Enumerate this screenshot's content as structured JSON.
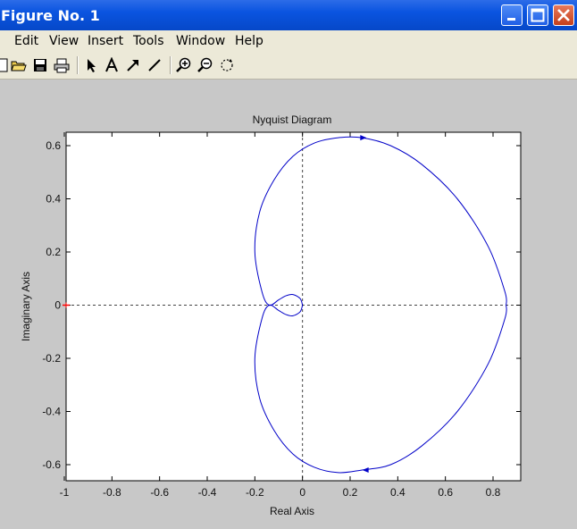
{
  "window": {
    "title": "Figure No. 1"
  },
  "menu": {
    "items": [
      "Edit",
      "View",
      "Insert",
      "Tools",
      "Window",
      "Help"
    ]
  },
  "toolbar": {
    "tools": [
      "open-folder-icon",
      "save-icon",
      "print-icon",
      "arrow-select-icon",
      "text-tool-icon",
      "arrow-tool-icon",
      "line-tool-icon",
      "zoom-in-icon",
      "zoom-out-icon",
      "rotate-icon"
    ]
  },
  "chart_data": {
    "type": "line",
    "title": "Nyquist Diagram",
    "xlabel": "Real Axis",
    "ylabel": "Imaginary Axis",
    "xlim": [
      -1,
      0.9
    ],
    "ylim": [
      -0.65,
      0.65
    ],
    "xticks": [
      "-1",
      "-0.8",
      "-0.6",
      "-0.4",
      "-0.2",
      "0",
      "0.2",
      "0.4",
      "0.6",
      "0.8"
    ],
    "yticks": [
      "0.6",
      "0.4",
      "0.2",
      "0",
      "-0.2",
      "-0.4",
      "-0.6"
    ],
    "grid": false,
    "curve_color": "#0000c8",
    "critical_point_color": "#ff0000",
    "critical_point": [
      -1,
      0
    ],
    "series": [
      {
        "values_positive_branch": [
          [
            0,
            0
          ],
          [
            -0.01,
            0.025
          ],
          [
            -0.04,
            0.04
          ],
          [
            -0.07,
            0.035
          ],
          [
            -0.1,
            0.02
          ],
          [
            -0.14,
            0.0
          ],
          [
            -0.17,
            0.05
          ],
          [
            -0.2,
            0.2
          ],
          [
            -0.18,
            0.35
          ],
          [
            -0.12,
            0.47
          ],
          [
            -0.04,
            0.56
          ],
          [
            0.05,
            0.61
          ],
          [
            0.15,
            0.63
          ],
          [
            0.25,
            0.63
          ],
          [
            0.37,
            0.6
          ],
          [
            0.5,
            0.53
          ],
          [
            0.65,
            0.4
          ],
          [
            0.78,
            0.22
          ],
          [
            0.85,
            0.05
          ],
          [
            0.855,
            0.0
          ]
        ],
        "values_negative_branch": [
          [
            0.855,
            0.0
          ],
          [
            0.85,
            -0.05
          ],
          [
            0.78,
            -0.22
          ],
          [
            0.65,
            -0.4
          ],
          [
            0.5,
            -0.53
          ],
          [
            0.37,
            -0.6
          ],
          [
            0.25,
            -0.62
          ],
          [
            0.15,
            -0.63
          ],
          [
            0.05,
            -0.61
          ],
          [
            -0.04,
            -0.56
          ],
          [
            -0.12,
            -0.47
          ],
          [
            -0.18,
            -0.35
          ],
          [
            -0.2,
            -0.2
          ],
          [
            -0.17,
            -0.05
          ],
          [
            -0.14,
            0.0
          ],
          [
            -0.1,
            -0.02
          ],
          [
            -0.07,
            -0.035
          ],
          [
            -0.04,
            -0.04
          ],
          [
            -0.01,
            -0.025
          ],
          [
            0,
            0
          ]
        ]
      }
    ]
  }
}
